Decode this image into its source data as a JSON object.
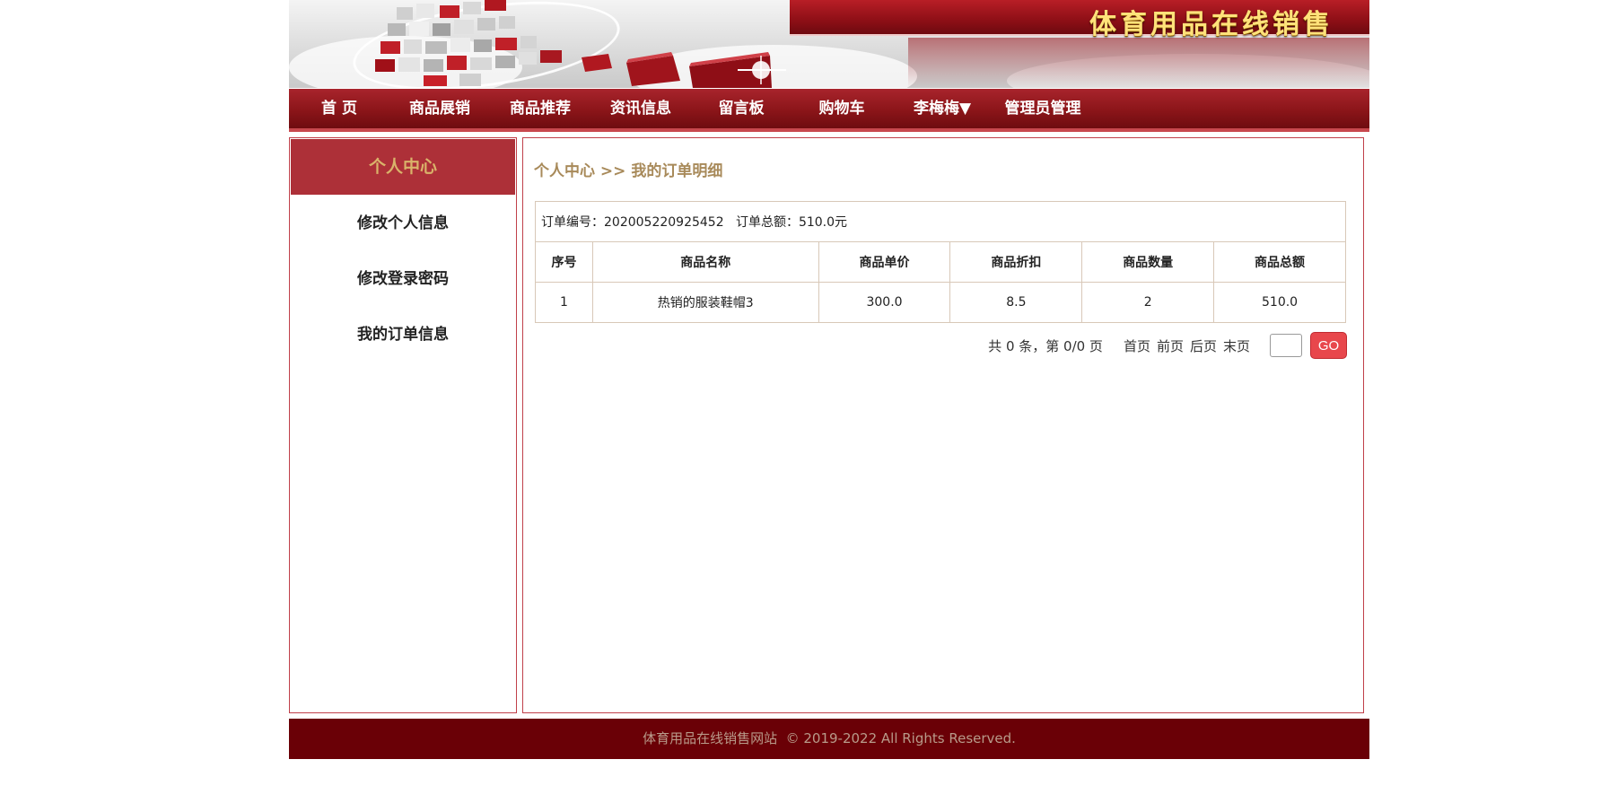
{
  "site": {
    "title": "体育用品在线销售"
  },
  "nav": {
    "items": [
      {
        "label": "首 页"
      },
      {
        "label": "商品展销"
      },
      {
        "label": "商品推荐"
      },
      {
        "label": "资讯信息"
      },
      {
        "label": "留言板"
      },
      {
        "label": "购物车"
      },
      {
        "label": "李梅梅▼"
      },
      {
        "label": "管理员管理"
      }
    ]
  },
  "sidebar": {
    "title": "个人中心",
    "items": [
      {
        "label": "修改个人信息"
      },
      {
        "label": "修改登录密码"
      },
      {
        "label": "我的订单信息"
      }
    ]
  },
  "main": {
    "breadcrumb": "个人中心 >> 我的订单明细",
    "order": {
      "info": "订单编号：202005220925452   订单总额：510.0元",
      "columns": [
        "序号",
        "商品名称",
        "商品单价",
        "商品折扣",
        "商品数量",
        "商品总额"
      ],
      "rows": [
        [
          "1",
          "热销的服装鞋帽3",
          "300.0",
          "8.5",
          "2",
          "510.0"
        ]
      ]
    },
    "pager": {
      "summary": "共 0 条，第 0/0 页",
      "first": "首页",
      "prev": "前页",
      "next": "后页",
      "last": "末页",
      "go": "GO"
    }
  },
  "footer": {
    "text": "体育用品在线销售网站  © 2019-2022 All Rights Reserved."
  },
  "colors": {
    "accent": "#8b1519",
    "footer": "#6a0006",
    "go_button": "#e8474c",
    "breadcrumb": "#a88a5a"
  }
}
